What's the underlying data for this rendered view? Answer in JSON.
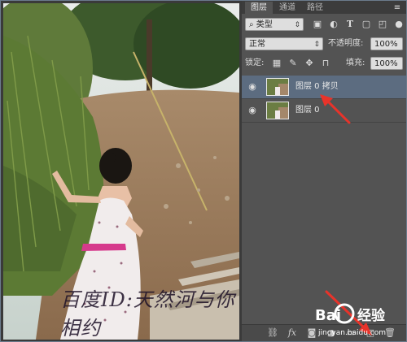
{
  "panel": {
    "tabs": [
      "图层",
      "通道",
      "路径"
    ],
    "filter": {
      "kind_label": "类型"
    },
    "blend_mode": "正常",
    "opacity_label": "不透明度:",
    "opacity_value": "100%",
    "lock_label": "锁定:",
    "fill_label": "填充:",
    "fill_value": "100%",
    "layers": [
      {
        "name": "图层 0 拷贝",
        "selected": true
      },
      {
        "name": "图层 0",
        "selected": false
      }
    ]
  },
  "watermark": {
    "text": "百度ID:天然河与你相约",
    "brand": "Bai度经验",
    "url": "jingyan.baidu.com"
  },
  "colors": {
    "annotation_arrow": "#e8332a",
    "selected_layer": "#5c6c80",
    "panel_bg": "#535353"
  }
}
